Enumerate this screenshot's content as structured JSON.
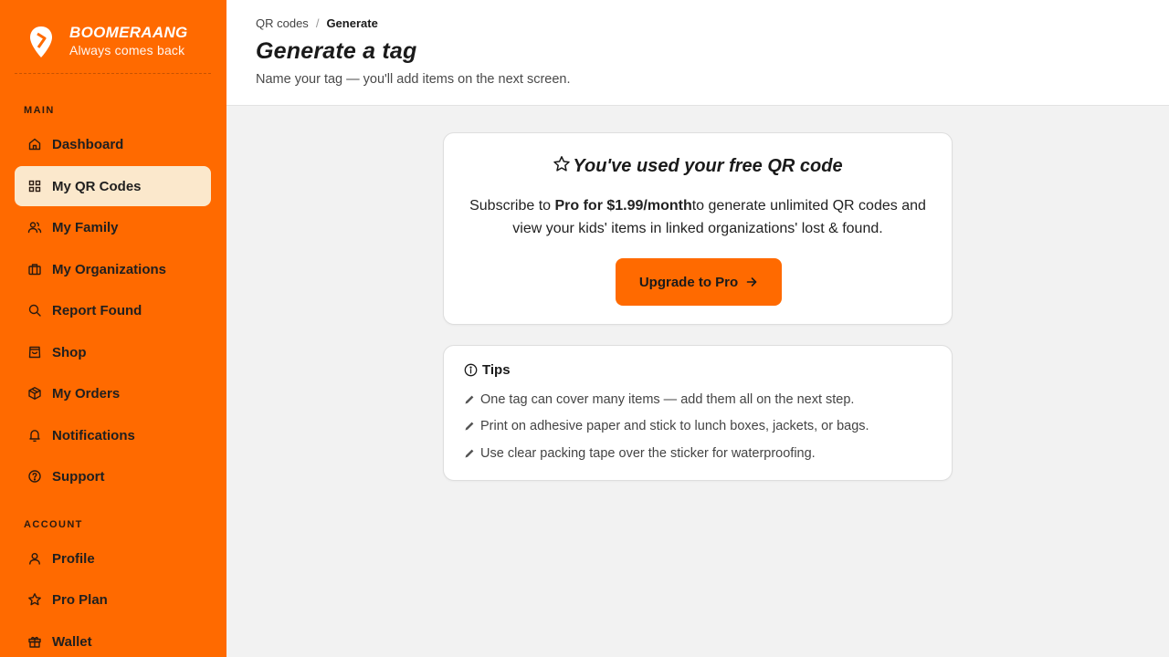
{
  "brand": {
    "name": "BOOMERAANG",
    "tagline": "Always comes back"
  },
  "sidebar": {
    "main_label": "MAIN",
    "account_label": "ACCOUNT",
    "main_items": [
      {
        "label": "Dashboard",
        "icon": "home-icon"
      },
      {
        "label": "My QR Codes",
        "icon": "grid-icon",
        "active": true
      },
      {
        "label": "My Family",
        "icon": "users-icon"
      },
      {
        "label": "My Organizations",
        "icon": "briefcase-icon"
      },
      {
        "label": "Report Found",
        "icon": "search-icon"
      },
      {
        "label": "Shop",
        "icon": "shopping-bag-icon"
      },
      {
        "label": "My Orders",
        "icon": "package-icon"
      },
      {
        "label": "Notifications",
        "icon": "bell-icon"
      },
      {
        "label": "Support",
        "icon": "help-circle-icon"
      }
    ],
    "account_items": [
      {
        "label": "Profile",
        "icon": "user-icon"
      },
      {
        "label": "Pro Plan",
        "icon": "star-icon"
      },
      {
        "label": "Wallet",
        "icon": "gift-icon"
      }
    ]
  },
  "header": {
    "breadcrumb": [
      "QR codes",
      "Generate"
    ],
    "breadcrumb_separator": "/",
    "title": "Generate a tag",
    "subtitle": "Name your tag — you'll add items on the next screen."
  },
  "upgrade_card": {
    "title": "You've used your free QR code",
    "body_prefix": "Subscribe to ",
    "body_bold": "Pro for $1.99/month",
    "body_suffix": "to generate unlimited QR codes and view your kids' items in linked organizations' lost & found.",
    "button_label": "Upgrade to Pro"
  },
  "tips_card": {
    "title": "Tips",
    "items": [
      "One tag can cover many items — add them all on the next step.",
      "Print on adhesive paper and stick to lunch boxes, jackets, or bags.",
      "Use clear packing tape over the sticker for waterproofing."
    ]
  },
  "colors": {
    "accent": "#ff6a00",
    "active_bg": "#fbe8cc",
    "page_bg": "#f2f2f2"
  }
}
